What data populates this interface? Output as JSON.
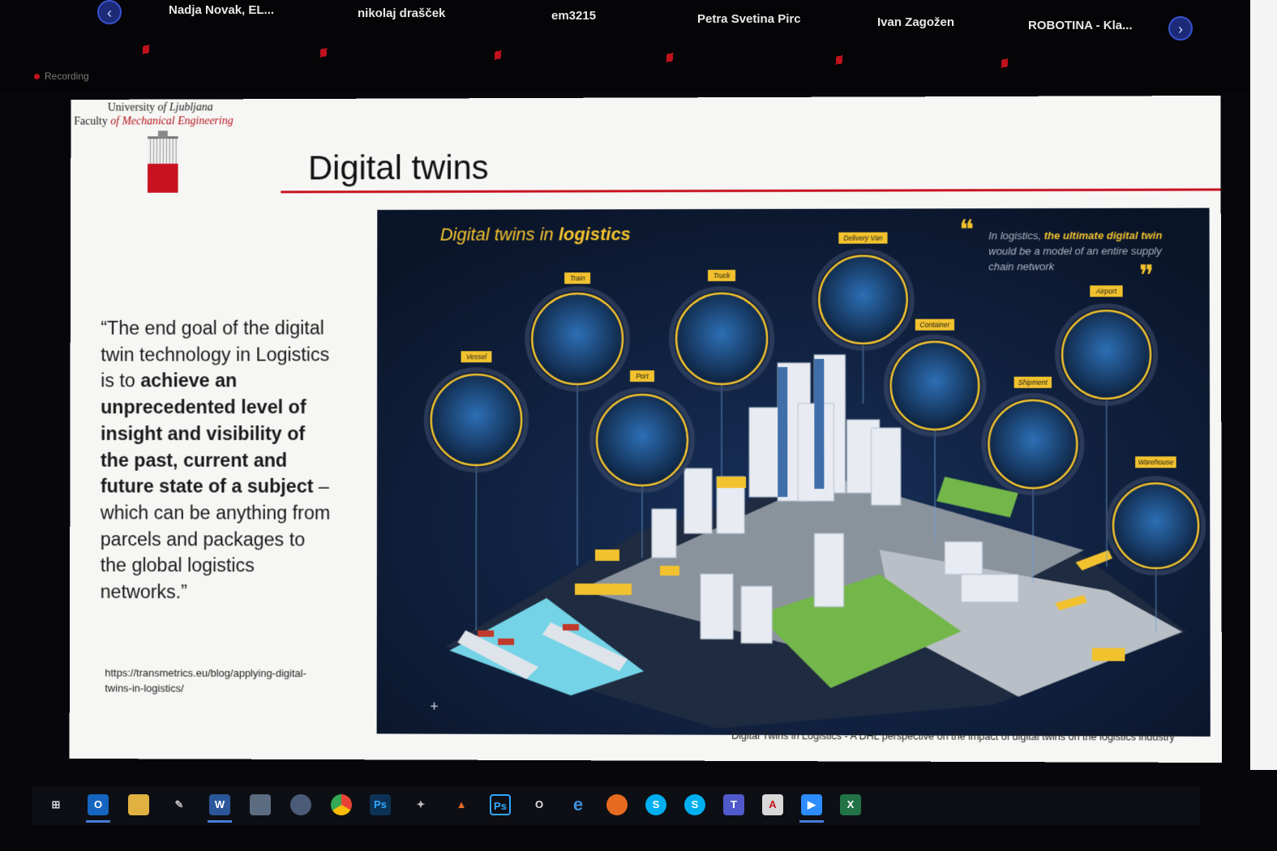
{
  "participants": {
    "prev_icon": "chevron-left-icon",
    "next_icon": "chevron-right-icon",
    "names": [
      "Nadja Novak, EL...",
      "nikolaj drašček",
      "em3215",
      "Petra Svetina Pirc",
      "Ivan Zagožen",
      "ROBOTINA - Kla..."
    ]
  },
  "recording": {
    "label": "Recording"
  },
  "slide": {
    "university": "University",
    "of_ljubljana": "of Ljubljana",
    "faculty": "Faculty",
    "of_mech": "of Mechanical Engineering",
    "title": "Digital twins",
    "quote": {
      "p1": "“The end goal of the digital twin technology in Logistics is to ",
      "bold": "achieve an unprecedented level of insight and visibility of the past, current and future state of a subject",
      "p2": " – which can be anything from parcels and packages to the global logistics networks.”"
    },
    "source": "https://transmetrics.eu/blog/applying-digital-twins-in-logistics/",
    "caption": "Digital Twins in Logistics - A DHL perspective on the impact of digital twins on the logistics industry"
  },
  "infographic": {
    "title_plain": "Digital twins in ",
    "title_bold": "logistics",
    "quote_mark": "❝",
    "quote_mark_close": "❞",
    "quote_p1": "In logistics, ",
    "quote_bold": "the ultimate digital twin",
    "quote_p2": " would be a model of an entire supply chain network",
    "nodes": [
      "Vessel",
      "Train",
      "Port",
      "Truck",
      "Delivery Van",
      "Container",
      "Shipment",
      "Airport",
      "Warehouse"
    ],
    "accent": "#f2c22e"
  },
  "taskbar": {
    "icons": [
      "windows-start-icon",
      "outlook-icon",
      "file-explorer-icon",
      "pen-icon",
      "word-icon",
      "notes-icon",
      "sync-icon",
      "chrome-icon",
      "photoshop-icon",
      "tool-icon",
      "matlab-icon",
      "photoshop-alt-icon",
      "office-icon",
      "edge-icon",
      "firefox-icon",
      "skype-business-icon",
      "skype-icon",
      "teams-icon",
      "acrobat-icon",
      "zoom-icon",
      "excel-icon"
    ]
  }
}
